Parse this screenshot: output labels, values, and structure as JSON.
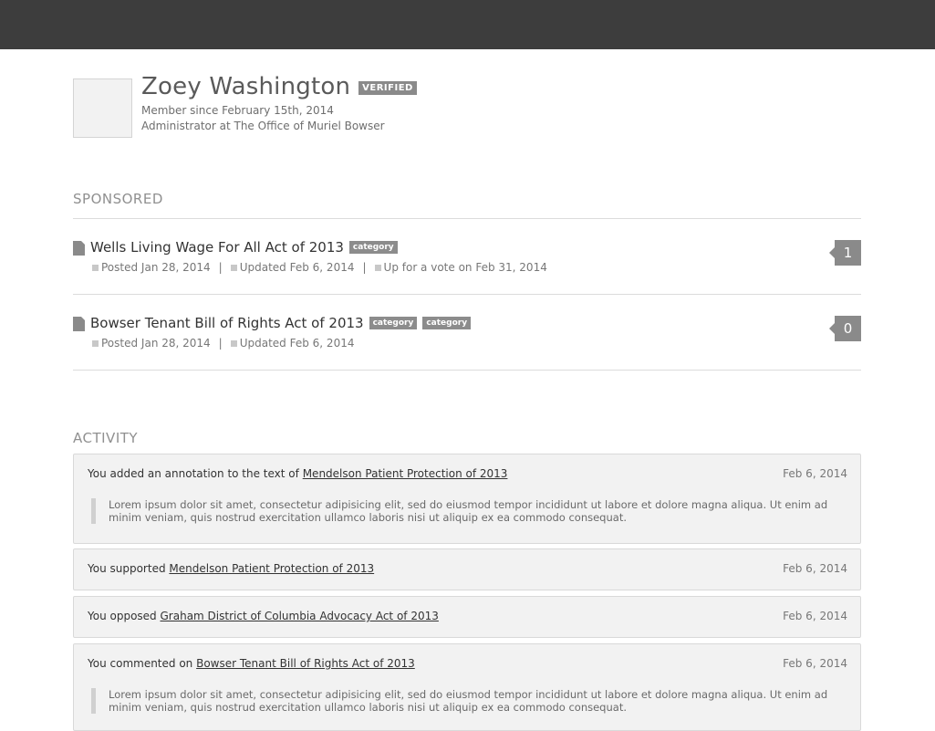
{
  "profile": {
    "name": "Zoey Washington",
    "badge": "VERIFIED",
    "member_since": "Member since February 15th, 2014",
    "role": "Administrator at The Office of Muriel Bowser"
  },
  "sponsored": {
    "title": "SPONSORED",
    "bills": [
      {
        "title": "Wells Living Wage For All Act of 2013",
        "categories": [
          "category"
        ],
        "posted": "Posted Jan 28, 2014",
        "updated": "Updated Feb 6, 2014",
        "vote": "Up for a vote on Feb 31, 2014",
        "count": "1"
      },
      {
        "title": "Bowser Tenant Bill of Rights Act of 2013",
        "categories": [
          "category",
          "category"
        ],
        "posted": "Posted Jan 28, 2014",
        "updated": "Updated Feb 6, 2014",
        "count": "0"
      }
    ]
  },
  "activity": {
    "title": "ACTIVITY",
    "items": [
      {
        "prefix": "You added an annotation to the text of",
        "link": "Mendelson Patient Protection of 2013",
        "date": "Feb 6, 2014",
        "quote": "Lorem ipsum dolor sit amet, consectetur adipisicing elit, sed do eiusmod tempor incididunt ut labore et dolore magna aliqua. Ut enim ad minim veniam, quis nostrud exercitation ullamco laboris nisi ut aliquip ex ea commodo consequat."
      },
      {
        "prefix": "You supported",
        "link": "Mendelson Patient Protection of 2013",
        "date": "Feb 6, 2014"
      },
      {
        "prefix": "You opposed",
        "link": "Graham District of Columbia Advocacy Act of 2013",
        "date": "Feb 6, 2014"
      },
      {
        "prefix": "You commented on",
        "link": "Bowser Tenant Bill of Rights Act of 2013",
        "date": "Feb 6, 2014",
        "quote": "Lorem ipsum dolor sit amet, consectetur adipisicing elit, sed do eiusmod tempor incididunt ut labore et dolore magna aliqua. Ut enim ad minim veniam, quis nostrud exercitation ullamco laboris nisi ut aliquip ex ea commodo consequat."
      }
    ]
  }
}
